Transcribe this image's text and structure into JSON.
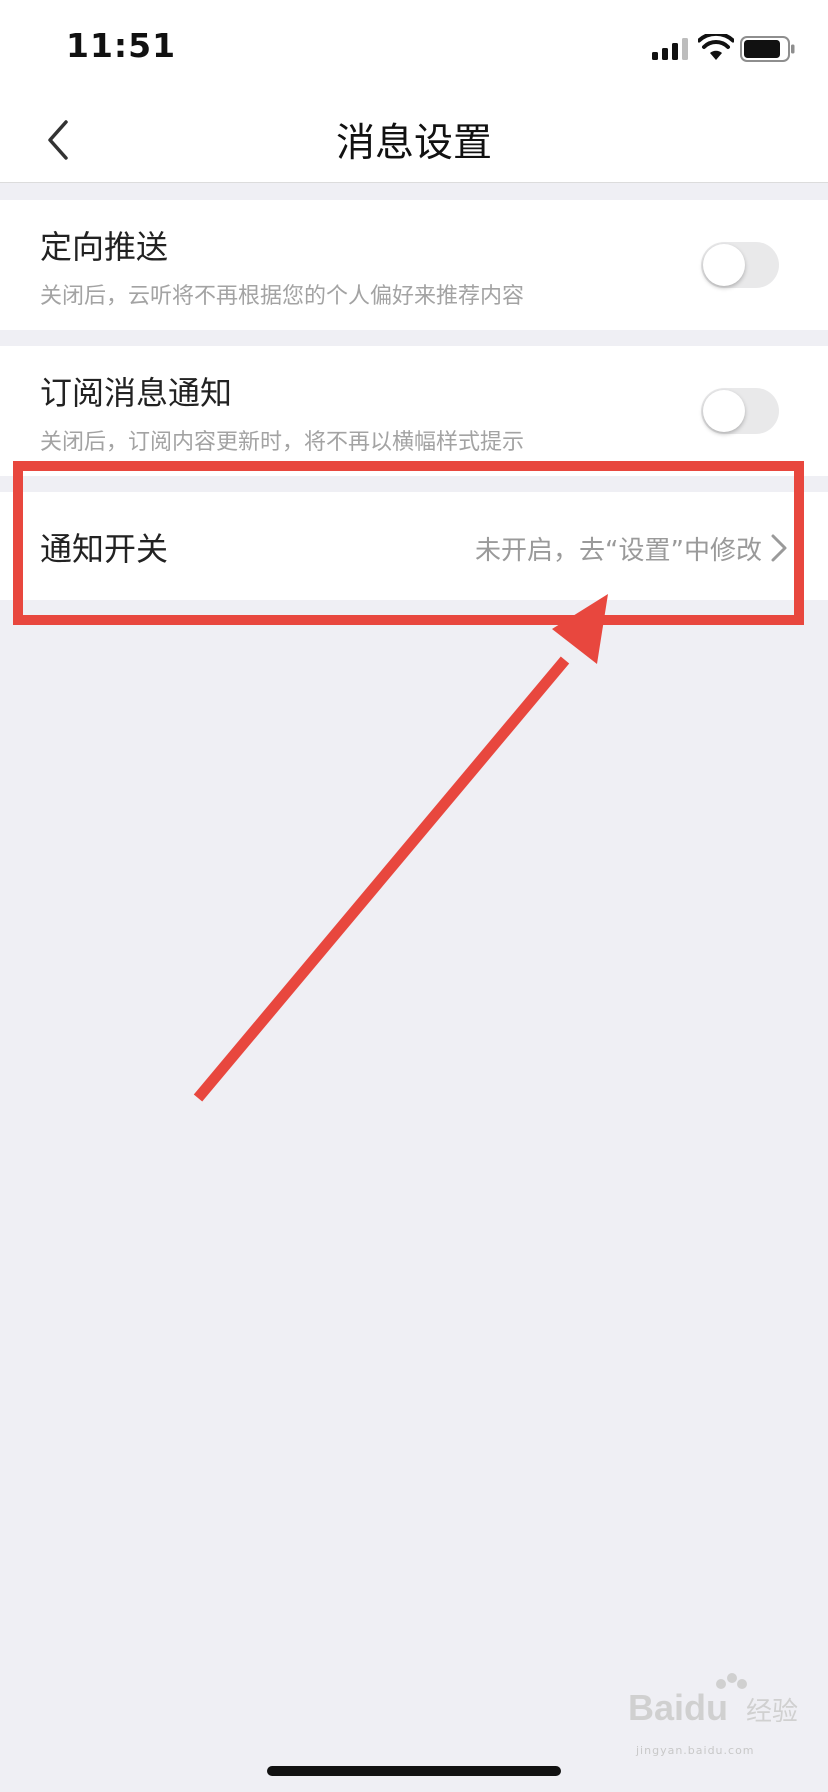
{
  "status_bar": {
    "time": "11:51"
  },
  "header": {
    "title": "消息设置"
  },
  "settings": {
    "targeted_push": {
      "title": "定向推送",
      "subtitle": "关闭后，云听将不再根据您的个人偏好来推荐内容",
      "enabled": false
    },
    "subscription_notice": {
      "title": "订阅消息通知",
      "subtitle": "关闭后，订阅内容更新时，将不再以横幅样式提示",
      "enabled": false
    },
    "notification_switch": {
      "title": "通知开关",
      "value": "未开启，去“设置”中修改"
    }
  },
  "watermark": {
    "brand": "Baidu",
    "suffix": "经验",
    "url": "jingyan.baidu.com"
  },
  "colors": {
    "annotation": "#e8473e",
    "background": "#efeff4",
    "toggle_off": "#e9e9ea"
  }
}
